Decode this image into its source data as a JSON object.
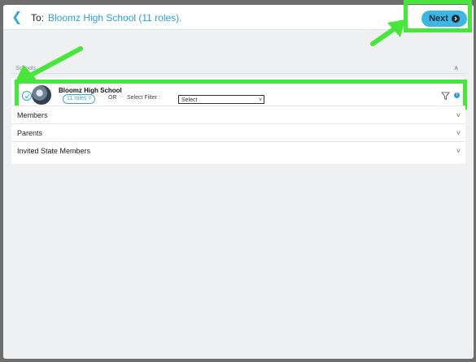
{
  "header": {
    "to_label": "To:",
    "to_value": "Bloomz High School (11 roles).",
    "next_label": "Next"
  },
  "schools": {
    "section_title": "Schools",
    "school_name": "Bloomz High School",
    "roles_label": "11 roles",
    "or_label": "OR",
    "filter_label": "Select Filter :",
    "select_value": "Select"
  },
  "groups": {
    "members": "Members",
    "parents": "Parents",
    "invited": "Invited State Members"
  },
  "colors": {
    "accent": "#3fb6e2",
    "highlight": "#46e63b"
  }
}
